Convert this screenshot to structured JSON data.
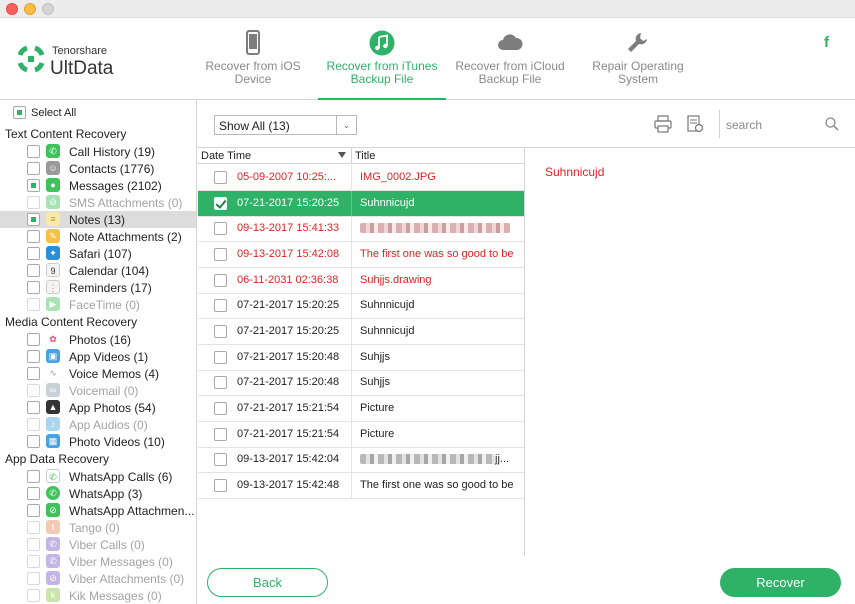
{
  "brand": {
    "company": "Tenorshare",
    "product": "UltData",
    "accent": "#2fb267"
  },
  "nav": [
    {
      "label1": "Recover from iOS",
      "label2": "Device",
      "icon": "phone-icon"
    },
    {
      "label1": "Recover from iTunes",
      "label2": "Backup File",
      "icon": "music-note-icon",
      "active": true
    },
    {
      "label1": "Recover from iCloud",
      "label2": "Backup File",
      "icon": "cloud-icon"
    },
    {
      "label1": "Repair Operating",
      "label2": "System",
      "icon": "wrench-icon"
    }
  ],
  "social": {
    "facebook": "f"
  },
  "sidebar": {
    "select_all": "Select All",
    "sections": {
      "text": "Text Content Recovery",
      "media": "Media Content Recovery",
      "app": "App Data Recovery"
    },
    "items": [
      {
        "label": "Call History (19)"
      },
      {
        "label": "Contacts (1776)"
      },
      {
        "label": "Messages (2102)"
      },
      {
        "label": "SMS Attachments (0)"
      },
      {
        "label": "Notes (13)"
      },
      {
        "label": "Note Attachments (2)"
      },
      {
        "label": "Safari (107)"
      },
      {
        "label": "Calendar (104)"
      },
      {
        "label": "Reminders (17)"
      },
      {
        "label": "FaceTime (0)"
      },
      {
        "label": "Photos (16)"
      },
      {
        "label": "App Videos (1)"
      },
      {
        "label": "Voice Memos (4)"
      },
      {
        "label": "Voicemail (0)"
      },
      {
        "label": "App Photos (54)"
      },
      {
        "label": "App Audios (0)"
      },
      {
        "label": "Photo Videos (10)"
      },
      {
        "label": "WhatsApp Calls (6)"
      },
      {
        "label": "WhatsApp (3)"
      },
      {
        "label": "WhatsApp Attachmen..."
      },
      {
        "label": "Tango (0)"
      },
      {
        "label": "Viber Calls (0)"
      },
      {
        "label": "Viber Messages (0)"
      },
      {
        "label": "Viber Attachments (0)"
      },
      {
        "label": "Kik Messages (0)"
      }
    ]
  },
  "toolbar": {
    "filter_value": "Show All (13)",
    "search_placeholder": "search",
    "print_icon": "print-icon",
    "export_icon": "export-settings-icon"
  },
  "table": {
    "col_date": "Date Time",
    "col_title": "Title",
    "rows": [
      {
        "date": "05-09-2007 10:25:...",
        "title": "IMG_0002.JPG",
        "red": true
      },
      {
        "date": "07-21-2017 15:20:25",
        "title": "Suhnnicujd",
        "selected": true,
        "checked": true
      },
      {
        "date": "09-13-2017 15:41:33",
        "title": "",
        "red": true,
        "blurred": true
      },
      {
        "date": "09-13-2017 15:42:08",
        "title": "The first one was so good to be",
        "red": true
      },
      {
        "date": "06-11-2031 02:36:38",
        "title": "Suhjjs.drawing",
        "red": true
      },
      {
        "date": "07-21-2017 15:20:25",
        "title": "Suhnnicujd"
      },
      {
        "date": "07-21-2017 15:20:25",
        "title": "Suhnnicujd"
      },
      {
        "date": "07-21-2017 15:20:48",
        "title": "Suhjjs"
      },
      {
        "date": "07-21-2017 15:20:48",
        "title": "Suhjjs"
      },
      {
        "date": "07-21-2017 15:21:54",
        "title": "Picture"
      },
      {
        "date": "07-21-2017 15:21:54",
        "title": "Picture"
      },
      {
        "date": "09-13-2017 15:42:04",
        "title": "jj...",
        "blurred": true
      },
      {
        "date": "09-13-2017 15:42:48",
        "title": "The first one was so good to be"
      }
    ]
  },
  "preview": {
    "text": "Suhnnicujd"
  },
  "buttons": {
    "back": "Back",
    "recover": "Recover"
  }
}
